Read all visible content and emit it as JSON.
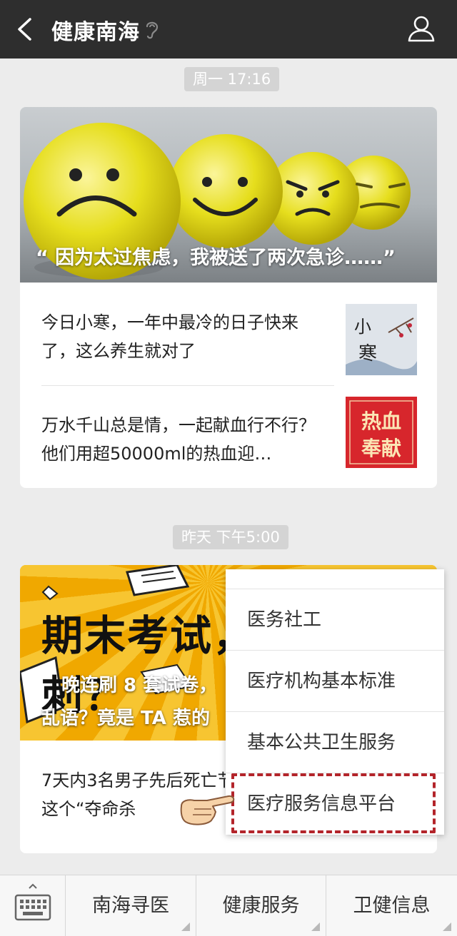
{
  "header": {
    "title": "健康南海"
  },
  "feed": {
    "group1": {
      "time": "周一 17:16",
      "headline": "“ 因为太过焦虑，我被送了两次急诊……”",
      "items": [
        {
          "text": "今日小寒，一年中最冷的日子快来了，这么养生就对了",
          "thumb_text": "小寒"
        },
        {
          "text": "万水千山总是情，一起献血行不行？他们用超50000ml的热血迎…",
          "thumb_text": "热血奉献"
        }
      ]
    },
    "group2": {
      "time": "昨天 下午5:00",
      "hero_title": "期末考试，刷题冲刺？",
      "hero_sub1": "晚连刷 8 套试卷，",
      "hero_sub2": "乱语？竟是 TA 惹的",
      "item_text": "7天内3名男子先后死亡节，这个“夺命杀"
    }
  },
  "popup_menu": {
    "items": [
      "医务社工",
      "医疗机构基本标准",
      "基本公共卫生服务",
      "医疗服务信息平台"
    ],
    "highlight_color": "#b3242a"
  },
  "bottom_menu": {
    "tabs": [
      "南海寻医",
      "健康服务",
      "卫健信息"
    ]
  },
  "colors": {
    "topbar": "#2e2e2e",
    "background": "#ececec"
  }
}
